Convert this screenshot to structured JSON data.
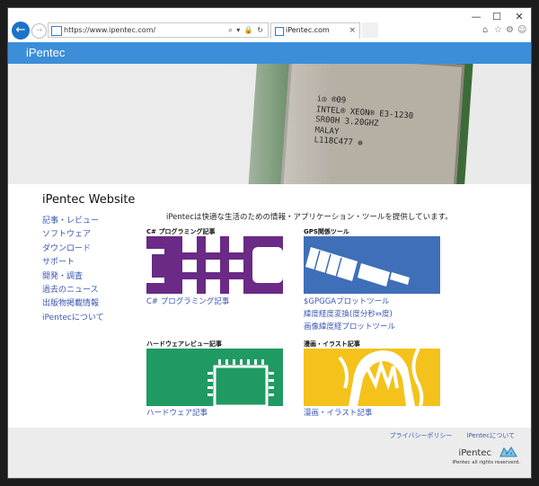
{
  "browser": {
    "window_controls": {
      "minimize": "—",
      "maximize": "☐",
      "close": "✕"
    },
    "back_icon": "←",
    "forward_icon": "→",
    "address": {
      "url": "https://www.ipentec.com/",
      "controls": "⌕ ▾ 🔒 ↻"
    },
    "tab": {
      "title": "iPentec.com",
      "close": "×"
    },
    "toolbar_icons": {
      "home": "⌂",
      "favorites": "☆",
      "settings": "⚙",
      "feedback": "☺"
    },
    "colors": {
      "accent": "#1a73c9"
    }
  },
  "site": {
    "logo": "iPentec",
    "header_color": "#3c8ed9",
    "hero_chip_text": "i◎ ®09\nINTEL® XEON® E3-1230\nSR00H 3.20GHZ\nMALAY\nL118C477 ⊕",
    "title": "iPentec Website",
    "tagline": "iPentecは快適な生活のための情報・アプリケーション・ツールを提供しています。",
    "nav": [
      "記事・レビュー",
      "ソフトウェア",
      "ダウンロード",
      "サポート",
      "開発・調査",
      "過去のニュース",
      "出版物掲載情報",
      "iPentecについて"
    ],
    "cards": [
      {
        "title": "C# プログラミング記事",
        "tile_color": "#6a2a86",
        "links": [
          "C# プログラミング記事"
        ]
      },
      {
        "title": "GPS関係ツール",
        "tile_color": "#3f6fb8",
        "links": [
          "$GPGGAプロットツール",
          "緯度経度変換(度分秒⇔度)",
          "画像緯度経プロットツール"
        ]
      },
      {
        "title": "ハードウェアレビュー記事",
        "tile_color": "#1f9a62",
        "links": [
          "ハードウェア記事"
        ]
      },
      {
        "title": "漫画・イラスト記事",
        "tile_color": "#f4c21a",
        "links": [
          "漫画・イラスト記事"
        ]
      }
    ],
    "footer": {
      "links": [
        "プライバシーポリシー",
        "iPentecについて"
      ],
      "logo": "iPentec",
      "copyright": "iPentec all rights reserverd."
    }
  }
}
